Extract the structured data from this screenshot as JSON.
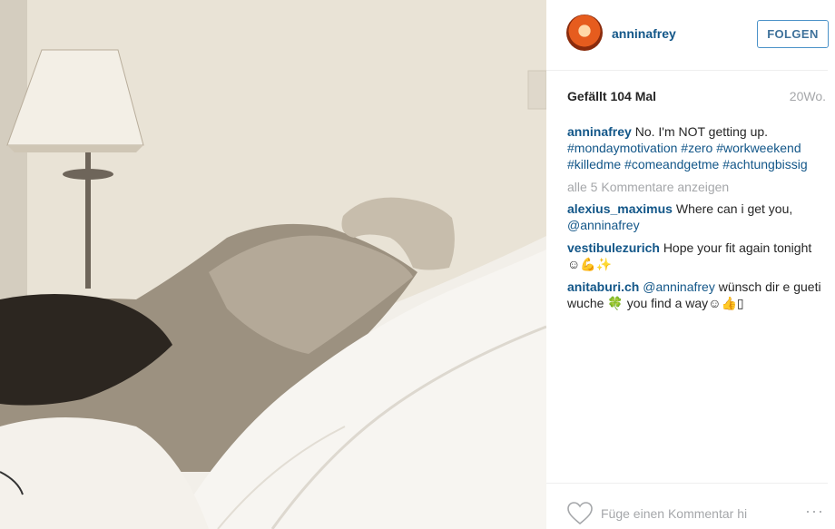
{
  "post": {
    "author": "anninafrey",
    "follow_label": "FOLGEN",
    "likes": "Gefällt 104 Mal",
    "age": "20Wo."
  },
  "caption": {
    "user": "anninafrey",
    "text": "No. I'm NOT getting up.",
    "hashtags": [
      "#mondaymotivation",
      "#zero",
      "#workweekend",
      "#killedme",
      "#comeandgetme",
      "#achtungbissig"
    ]
  },
  "view_all_comments": "alle 5 Kommentare anzeigen",
  "comments": [
    {
      "user": "alexius_maximus",
      "text": "Where can i get you,",
      "mention": "@anninafrey",
      "rest": ""
    },
    {
      "user": "vestibulezurich",
      "text": "Hope your fit again tonight",
      "emoji": "☺💪✨"
    },
    {
      "user": "anitaburi.ch",
      "mention": "@anninafrey",
      "text": "wünsch dir e gueti wuche",
      "emoji_mid": "🍀",
      "text2": "you find a way",
      "emoji_end": "☺👍▯"
    }
  ],
  "footer": {
    "comment_placeholder": "Füge einen Kommentar hi",
    "options_glyph": "···"
  },
  "colors": {
    "link": "#125688",
    "muted": "#a5a7aa",
    "follow_border": "#4b92c8"
  }
}
